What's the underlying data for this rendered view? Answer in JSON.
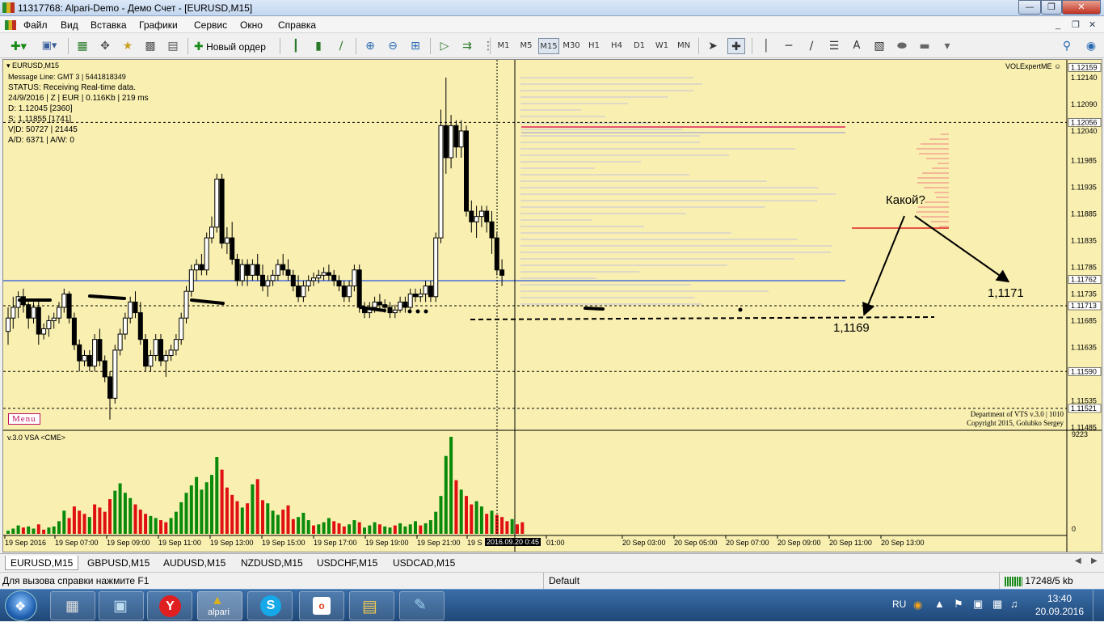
{
  "window": {
    "title": "11317768: Alpari-Demo - Демо Счет - [EURUSD,M15]",
    "min_icon": "minimize-icon",
    "max_icon": "maximize-icon",
    "close_icon": "close-icon"
  },
  "menu": {
    "items": [
      "Файл",
      "Вид",
      "Вставка",
      "Графики",
      "Сервис",
      "Окно",
      "Справка"
    ]
  },
  "toolbar": {
    "new_order_label": "Новый ордер",
    "timeframes": [
      "M1",
      "M5",
      "M15",
      "M30",
      "H1",
      "H4",
      "D1",
      "W1",
      "MN"
    ],
    "active_timeframe": "M15"
  },
  "chart": {
    "symbol_label": "EURUSD,M15",
    "info_lines": [
      "Message Line: GMT 3 | 5441818349",
      "STATUS:  Receiving Real-time data.",
      "24/9/2016 | Z | EUR | 0.116Kb | 219 ms",
      "D: 1.12045  [2360]",
      "S: 1.11855  [1741]",
      "V|D: 50727 | 21445",
      "A/D: 6371 | A/W: 0"
    ],
    "top_right_label": "VOLExpertME",
    "menu_button": "Menu",
    "copyright_1": "Department of VTS  v.3.0 | 1010",
    "copyright_2": "Copyright 2015, Golubko Sergey",
    "annotation_question": "Какой?",
    "annotation_upper": "1,1171",
    "annotation_lower": "1,1169",
    "crosshair_time": "2016.09.20 0:45",
    "indicator_label": "v.3.0 VSA <CME>",
    "indicator_max": "9223",
    "indicator_min": "0",
    "price_scale": [
      "1.12159",
      "1.12140",
      "1.12090",
      "1.12056",
      "1.12040",
      "1.11985",
      "1.11935",
      "1.11885",
      "1.11835",
      "1.11785",
      "1.11762",
      "1.11735",
      "1.11713",
      "1.11685",
      "1.11635",
      "1.11590",
      "1.11535",
      "1.11521",
      "1.11485"
    ],
    "highlighted_prices": [
      "1.12159",
      "1.12056",
      "1.11762",
      "1.11713",
      "1.11590",
      "1.11521"
    ],
    "time_labels": [
      "19 Sep 2016",
      "19 Sep 07:00",
      "19 Sep 09:00",
      "19 Sep 11:00",
      "19 Sep 13:00",
      "19 Sep 15:00",
      "19 Sep 17:00",
      "19 Sep 19:00",
      "19 Sep 21:00",
      "19 S",
      "01:00",
      "20 Sep 03:00",
      "20 Sep 05:00",
      "20 Sep 07:00",
      "20 Sep 09:00",
      "20 Sep 11:00",
      "20 Sep 13:00"
    ]
  },
  "chart_data": {
    "type": "candlestick",
    "symbol": "EURUSD",
    "timeframe": "M15",
    "ylim": [
      1.1148,
      1.1217
    ],
    "candles": [
      [
        1.11665,
        1.1171,
        1.1164,
        1.1169
      ],
      [
        1.1169,
        1.1173,
        1.1167,
        1.1171
      ],
      [
        1.1171,
        1.1174,
        1.1169,
        1.1173
      ],
      [
        1.1173,
        1.11745,
        1.117,
        1.11715
      ],
      [
        1.11715,
        1.1172,
        1.1167,
        1.1169
      ],
      [
        1.1169,
        1.1172,
        1.1168,
        1.1171
      ],
      [
        1.1171,
        1.11725,
        1.1164,
        1.1166
      ],
      [
        1.1166,
        1.1168,
        1.1165,
        1.1167
      ],
      [
        1.1167,
        1.11695,
        1.11655,
        1.11685
      ],
      [
        1.11685,
        1.117,
        1.1167,
        1.1169
      ],
      [
        1.1169,
        1.1172,
        1.1168,
        1.1171
      ],
      [
        1.1171,
        1.11745,
        1.117,
        1.11735
      ],
      [
        1.11735,
        1.1174,
        1.1168,
        1.1169
      ],
      [
        1.1169,
        1.117,
        1.1163,
        1.1164
      ],
      [
        1.1164,
        1.1165,
        1.1159,
        1.1161
      ],
      [
        1.1161,
        1.1163,
        1.116,
        1.1162
      ],
      [
        1.1162,
        1.1163,
        1.1159,
        1.116
      ],
      [
        1.116,
        1.1166,
        1.1159,
        1.1165
      ],
      [
        1.1165,
        1.1167,
        1.116,
        1.1161
      ],
      [
        1.1161,
        1.1162,
        1.1157,
        1.1158
      ],
      [
        1.1158,
        1.1159,
        1.115,
        1.1154
      ],
      [
        1.1154,
        1.1164,
        1.1153,
        1.1163
      ],
      [
        1.1163,
        1.1167,
        1.1162,
        1.1166
      ],
      [
        1.1166,
        1.117,
        1.1165,
        1.1169
      ],
      [
        1.1169,
        1.1173,
        1.1168,
        1.1172
      ],
      [
        1.1172,
        1.1174,
        1.1169,
        1.117
      ],
      [
        1.117,
        1.1172,
        1.1164,
        1.1165
      ],
      [
        1.1165,
        1.1166,
        1.1159,
        1.116
      ],
      [
        1.116,
        1.1163,
        1.1159,
        1.1162
      ],
      [
        1.1162,
        1.1166,
        1.1161,
        1.1165
      ],
      [
        1.1165,
        1.1166,
        1.116,
        1.1161
      ],
      [
        1.1161,
        1.1163,
        1.1158,
        1.1162
      ],
      [
        1.1162,
        1.1164,
        1.1161,
        1.1163
      ],
      [
        1.1163,
        1.1166,
        1.1162,
        1.1165
      ],
      [
        1.1165,
        1.117,
        1.1164,
        1.1169
      ],
      [
        1.1169,
        1.1175,
        1.1168,
        1.1174
      ],
      [
        1.1174,
        1.1179,
        1.1173,
        1.1178
      ],
      [
        1.1178,
        1.118,
        1.1176,
        1.1179
      ],
      [
        1.1179,
        1.1181,
        1.1177,
        1.1178
      ],
      [
        1.1178,
        1.1185,
        1.1177,
        1.1184
      ],
      [
        1.1184,
        1.1188,
        1.1183,
        1.1186
      ],
      [
        1.1186,
        1.1196,
        1.1185,
        1.1195
      ],
      [
        1.1195,
        1.1196,
        1.1182,
        1.1183
      ],
      [
        1.1183,
        1.1186,
        1.1181,
        1.1184
      ],
      [
        1.1184,
        1.1187,
        1.1179,
        1.118
      ],
      [
        1.118,
        1.1181,
        1.1175,
        1.1176
      ],
      [
        1.1176,
        1.118,
        1.1175,
        1.1179
      ],
      [
        1.1179,
        1.118,
        1.1175,
        1.1177
      ],
      [
        1.1177,
        1.118,
        1.1176,
        1.1179
      ],
      [
        1.1179,
        1.1181,
        1.1176,
        1.1177
      ],
      [
        1.1177,
        1.1179,
        1.1174,
        1.1175
      ],
      [
        1.1175,
        1.1177,
        1.1173,
        1.1176
      ],
      [
        1.1176,
        1.1178,
        1.1175,
        1.1177
      ],
      [
        1.1177,
        1.118,
        1.1176,
        1.1179
      ],
      [
        1.1179,
        1.1181,
        1.1177,
        1.1178
      ],
      [
        1.1178,
        1.118,
        1.1176,
        1.1177
      ],
      [
        1.1177,
        1.1178,
        1.1174,
        1.1175
      ],
      [
        1.1175,
        1.1177,
        1.1172,
        1.1173
      ],
      [
        1.1173,
        1.1176,
        1.1172,
        1.1175
      ],
      [
        1.1175,
        1.1177,
        1.1174,
        1.1176
      ],
      [
        1.1176,
        1.11775,
        1.1175,
        1.11765
      ],
      [
        1.11765,
        1.1178,
        1.11755,
        1.1177
      ],
      [
        1.1177,
        1.11785,
        1.1176,
        1.11775
      ],
      [
        1.11775,
        1.1179,
        1.1176,
        1.1177
      ],
      [
        1.1177,
        1.1178,
        1.1175,
        1.1176
      ],
      [
        1.1176,
        1.1177,
        1.1174,
        1.1175
      ],
      [
        1.1175,
        1.1176,
        1.1172,
        1.1173
      ],
      [
        1.1173,
        1.1176,
        1.1172,
        1.1175
      ],
      [
        1.1175,
        1.1179,
        1.1174,
        1.1178
      ],
      [
        1.1178,
        1.1179,
        1.117,
        1.1171
      ],
      [
        1.1171,
        1.1172,
        1.1169,
        1.117
      ],
      [
        1.117,
        1.1172,
        1.1169,
        1.1171
      ],
      [
        1.1171,
        1.1173,
        1.117,
        1.1172
      ],
      [
        1.1172,
        1.11735,
        1.11705,
        1.11715
      ],
      [
        1.11715,
        1.11725,
        1.117,
        1.1171
      ],
      [
        1.1171,
        1.1172,
        1.1169,
        1.117
      ],
      [
        1.117,
        1.11715,
        1.1169,
        1.11705
      ],
      [
        1.11705,
        1.1173,
        1.117,
        1.1172
      ],
      [
        1.1172,
        1.1173,
        1.117,
        1.1171
      ],
      [
        1.1171,
        1.11745,
        1.117,
        1.11735
      ],
      [
        1.11735,
        1.11745,
        1.1172,
        1.1173
      ],
      [
        1.1173,
        1.11745,
        1.1172,
        1.11735
      ],
      [
        1.11735,
        1.1176,
        1.1172,
        1.1175
      ],
      [
        1.1175,
        1.1176,
        1.1172,
        1.1173
      ],
      [
        1.1173,
        1.1185,
        1.1172,
        1.1184
      ],
      [
        1.1184,
        1.1208,
        1.1183,
        1.1205
      ],
      [
        1.1205,
        1.1214,
        1.1196,
        1.1199
      ],
      [
        1.1199,
        1.1207,
        1.1197,
        1.1205
      ],
      [
        1.1205,
        1.1206,
        1.1199,
        1.1201
      ],
      [
        1.1201,
        1.1206,
        1.1199,
        1.1204
      ],
      [
        1.1204,
        1.1205,
        1.1188,
        1.1189
      ],
      [
        1.1189,
        1.1191,
        1.1185,
        1.1187
      ],
      [
        1.1187,
        1.119,
        1.1184,
        1.1188
      ],
      [
        1.1188,
        1.119,
        1.1186,
        1.1189
      ],
      [
        1.1189,
        1.119,
        1.1185,
        1.1187
      ],
      [
        1.1187,
        1.1189,
        1.1181,
        1.1184
      ],
      [
        1.1184,
        1.1185,
        1.1177,
        1.1178
      ],
      [
        1.1178,
        1.118,
        1.1175,
        1.1177
      ]
    ],
    "volumes": [
      [
        300,
        1
      ],
      [
        500,
        1
      ],
      [
        800,
        1
      ],
      [
        600,
        0
      ],
      [
        700,
        1
      ],
      [
        500,
        1
      ],
      [
        900,
        0
      ],
      [
        400,
        0
      ],
      [
        600,
        1
      ],
      [
        700,
        1
      ],
      [
        1200,
        1
      ],
      [
        2200,
        1
      ],
      [
        1500,
        0
      ],
      [
        2600,
        0
      ],
      [
        2200,
        0
      ],
      [
        1900,
        0
      ],
      [
        1600,
        1
      ],
      [
        2800,
        0
      ],
      [
        2500,
        0
      ],
      [
        2100,
        0
      ],
      [
        3300,
        0
      ],
      [
        4100,
        1
      ],
      [
        4800,
        1
      ],
      [
        3900,
        1
      ],
      [
        3400,
        1
      ],
      [
        2800,
        0
      ],
      [
        2300,
        0
      ],
      [
        1900,
        0
      ],
      [
        1700,
        1
      ],
      [
        1500,
        1
      ],
      [
        1300,
        0
      ],
      [
        1100,
        0
      ],
      [
        1500,
        1
      ],
      [
        2100,
        1
      ],
      [
        3000,
        1
      ],
      [
        3900,
        1
      ],
      [
        4600,
        1
      ],
      [
        5400,
        1
      ],
      [
        4200,
        1
      ],
      [
        4900,
        1
      ],
      [
        5600,
        1
      ],
      [
        7300,
        1
      ],
      [
        6100,
        0
      ],
      [
        4400,
        0
      ],
      [
        3700,
        0
      ],
      [
        3100,
        0
      ],
      [
        2500,
        1
      ],
      [
        2900,
        0
      ],
      [
        4700,
        1
      ],
      [
        5200,
        0
      ],
      [
        3200,
        0
      ],
      [
        2900,
        1
      ],
      [
        2200,
        1
      ],
      [
        1800,
        1
      ],
      [
        2300,
        0
      ],
      [
        2700,
        0
      ],
      [
        1400,
        0
      ],
      [
        1600,
        1
      ],
      [
        2000,
        1
      ],
      [
        1300,
        1
      ],
      [
        800,
        0
      ],
      [
        900,
        1
      ],
      [
        1100,
        1
      ],
      [
        1500,
        1
      ],
      [
        1200,
        0
      ],
      [
        1000,
        0
      ],
      [
        700,
        0
      ],
      [
        900,
        1
      ],
      [
        1300,
        1
      ],
      [
        1100,
        0
      ],
      [
        600,
        1
      ],
      [
        800,
        1
      ],
      [
        1100,
        1
      ],
      [
        900,
        0
      ],
      [
        700,
        1
      ],
      [
        600,
        1
      ],
      [
        800,
        0
      ],
      [
        1000,
        1
      ],
      [
        700,
        1
      ],
      [
        900,
        1
      ],
      [
        1200,
        1
      ],
      [
        800,
        0
      ],
      [
        1000,
        1
      ],
      [
        1300,
        1
      ],
      [
        2100,
        1
      ],
      [
        3600,
        1
      ],
      [
        7400,
        1
      ],
      [
        9223,
        1
      ],
      [
        5100,
        0
      ],
      [
        4200,
        1
      ],
      [
        3600,
        0
      ],
      [
        2800,
        0
      ],
      [
        3100,
        1
      ],
      [
        2600,
        1
      ],
      [
        1900,
        0
      ],
      [
        2200,
        1
      ],
      [
        1800,
        0
      ],
      [
        1600,
        0
      ],
      [
        1200,
        0
      ],
      [
        1400,
        1
      ],
      [
        900,
        0
      ],
      [
        1100,
        0
      ]
    ],
    "levels": [
      1.12056,
      1.11762,
      1.11713,
      1.1159,
      1.11521,
      1.1169
    ]
  },
  "tabs": {
    "items": [
      "EURUSD,M15",
      "GBPUSD,M15",
      "AUDUSD,M15",
      "NZDUSD,M15",
      "USDCHF,M15",
      "USDCAD,M15"
    ],
    "active": "EURUSD,M15"
  },
  "status": {
    "help_text": "Для вызова справки нажмите F1",
    "profile": "Default",
    "traffic": "17248/5 kb"
  },
  "taskbar": {
    "language": "RU",
    "time": "13:40",
    "date": "20.09.2016",
    "app_label": "alpari"
  },
  "colors": {
    "chart_bg": "#f8efb0",
    "bull_volume": "#0a8a0a",
    "bear_volume": "#e01010",
    "level_line": "#6b84d8"
  }
}
